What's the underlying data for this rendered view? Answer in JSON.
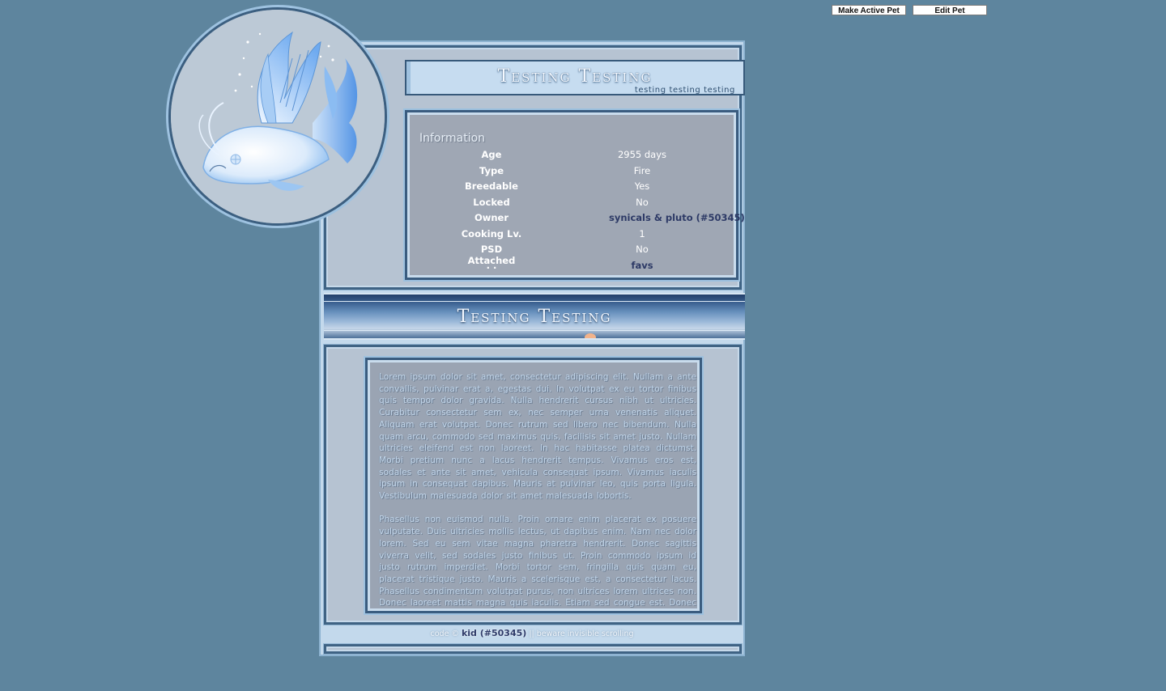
{
  "top_buttons": {
    "make_active": "Make Active Pet",
    "edit": "Edit Pet"
  },
  "header": {
    "title": "Testing Testing",
    "subtitle": "testing testing testing"
  },
  "info": {
    "heading": "Information",
    "rows": [
      {
        "label": "Age",
        "value": "2955 days"
      },
      {
        "label": "Type",
        "value": "Fire"
      },
      {
        "label": "Breedable",
        "value": "Yes"
      },
      {
        "label": "Locked",
        "value": "No"
      },
      {
        "label": "Owner",
        "value": "synicals & pluto (#50345)"
      },
      {
        "label": "Cooking Lv.",
        "value": "1"
      },
      {
        "label": "PSD Attached",
        "value": "No"
      },
      {
        "label": ". .",
        "value": "favs"
      }
    ]
  },
  "banner": {
    "title": "Testing Testing"
  },
  "content": {
    "paragraph_1": "Lorem ipsum dolor sit amet, consectetur adipiscing elit. Nullam a ante convallis, pulvinar erat a, egestas dui. In volutpat ex eu tortor finibus quis tempor dolor gravida. Nulla hendrerit cursus nibh ut ultricies. Curabitur consectetur sem ex, nec semper urna venenatis aliquet. Aliquam erat volutpat. Donec rutrum sed libero nec bibendum. Nulla quam arcu, commodo sed maximus quis, facilisis sit amet justo. Nullam ultricies eleifend est non laoreet. In hac habitasse platea dictumst. Morbi pretium nunc a lacus hendrerit tempus. Vivamus eros est, sodales et ante sit amet, vehicula consequat ipsum. Vivamus iaculis ipsum in consequat dapibus. Mauris at pulvinar leo, quis porta ligula. Vestibulum malesuada dolor sit amet malesuada lobortis.",
    "paragraph_2": "Phasellus non euismod nulla. Proin ornare enim placerat ex posuere vulputate. Duis ultricies mollis lectus, ut dapibus enim. Nam nec dolor lorem. Sed eu sem vitae magna pharetra hendrerit. Donec sagittis viverra velit, sed sodales justo finibus ut. Proin commodo ipsum id justo rutrum imperdiet. Morbi tortor sem, fringilla quis quam eu, placerat tristique justo. Mauris a scelerisque est, a consectetur lacus. Phasellus condimentum volutpat purus, non ultrices lorem ultrices non. Donec laoreet mattis magna quis iaculis. Etiam sed congue est. Donec ac"
  },
  "footer": {
    "prefix": "code ©",
    "author": "kid (#50345)",
    "suffix": "|| beware invisible scrolling"
  },
  "colors": {
    "page_background": "#5e859e",
    "panel_light": "#c3d9ec",
    "panel_border_dark": "#3a5c7f",
    "info_box_bg": "#9fa7b4",
    "owner_link": "#2d3a66"
  },
  "icons": {
    "avatar": "winged-koi-pet-image"
  }
}
